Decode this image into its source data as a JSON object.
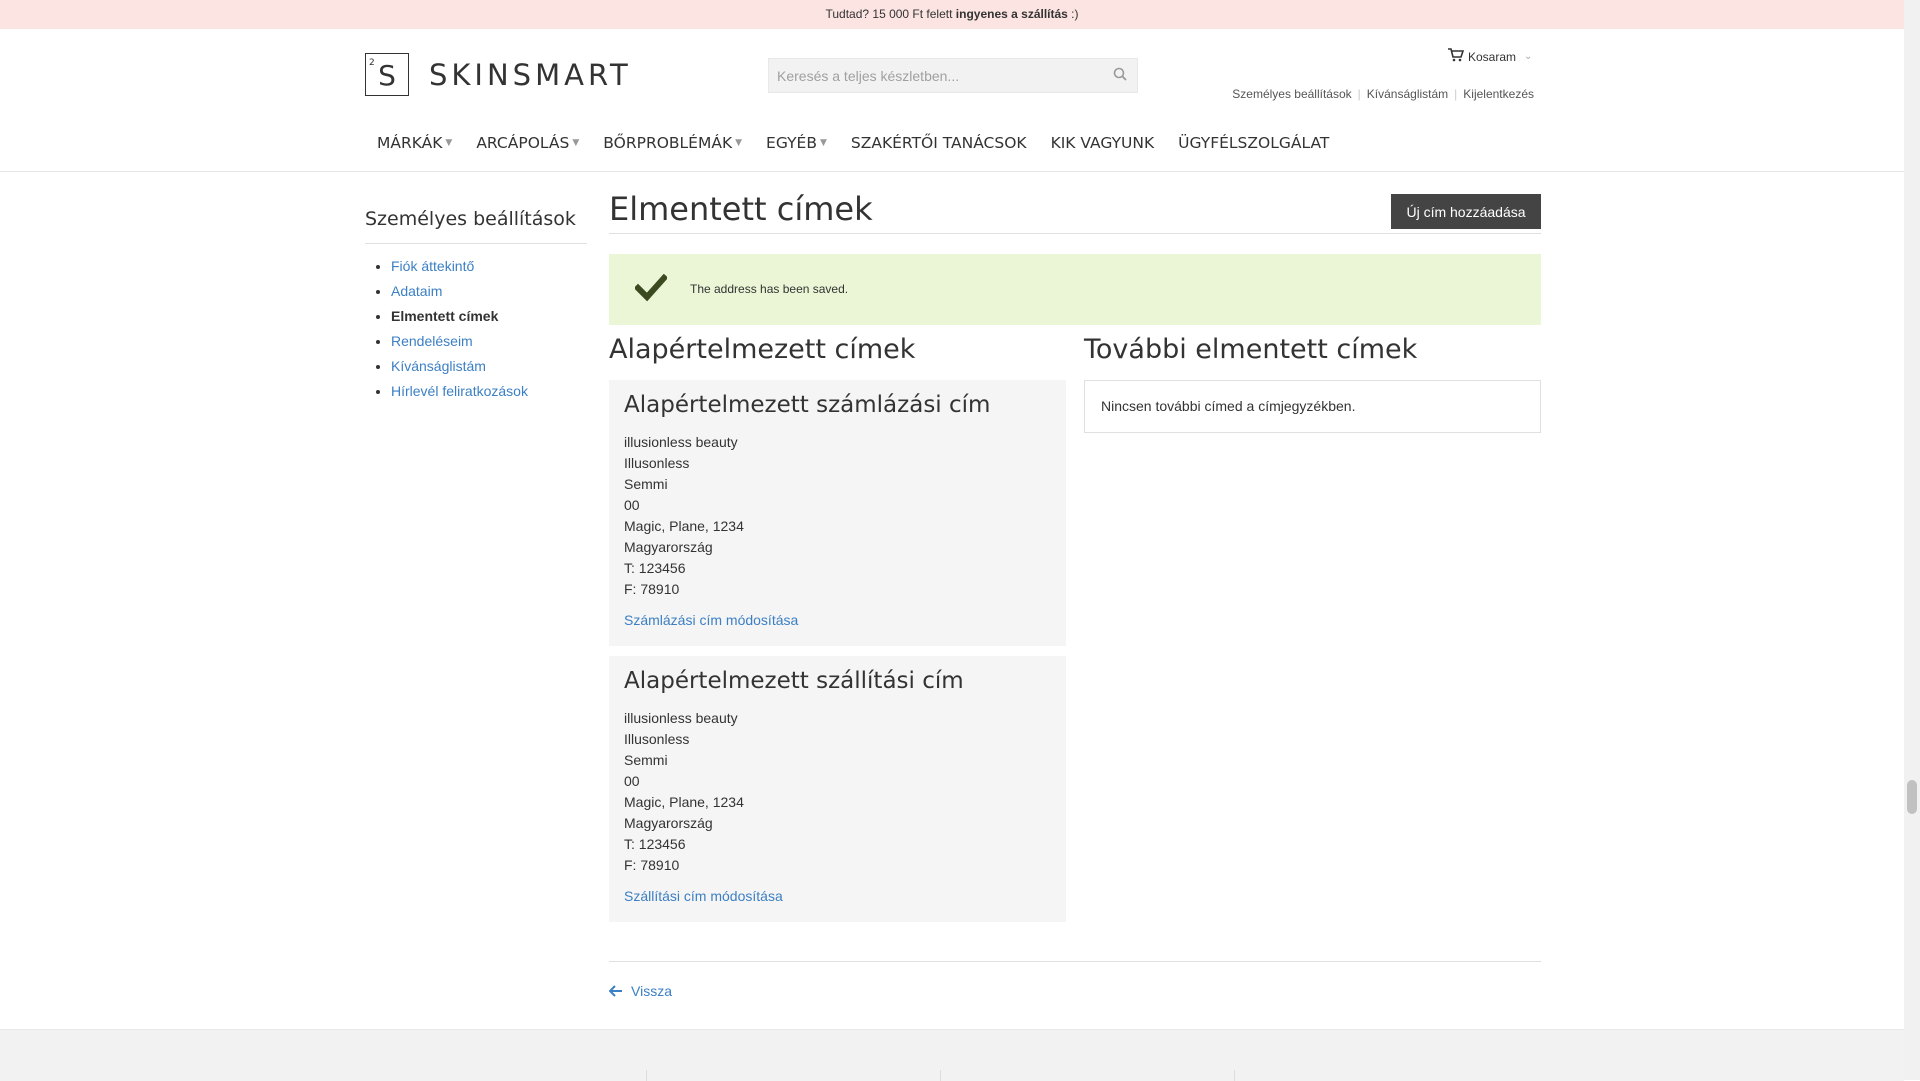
{
  "promo": {
    "prefix": "Tudtad? 15 000 Ft felett ",
    "bold": "ingyenes a szállítás",
    "suffix": " :)"
  },
  "brand": {
    "logo_letter": "S",
    "logo_sup": "2",
    "name": "SKINSMART"
  },
  "search": {
    "placeholder": "Keresés a teljes készletben..."
  },
  "cart": {
    "label": "Kosaram"
  },
  "toplinks": [
    "Személyes beállítások",
    "Kívánságlistám",
    "Kijelentkezés"
  ],
  "nav": [
    {
      "label": "MÁRKÁK",
      "has_dropdown": true
    },
    {
      "label": "ARCÁPOLÁS",
      "has_dropdown": true
    },
    {
      "label": "BŐRPROBLÉMÁK",
      "has_dropdown": true
    },
    {
      "label": "EGYÉB",
      "has_dropdown": true
    },
    {
      "label": "SZAKÉRTŐI TANÁCSOK",
      "has_dropdown": false
    },
    {
      "label": "KIK VAGYUNK",
      "has_dropdown": false
    },
    {
      "label": "ÜGYFÉLSZOLGÁLAT",
      "has_dropdown": false
    }
  ],
  "sidebar": {
    "title": "Személyes beállítások",
    "items": [
      {
        "label": "Fiók áttekintő",
        "current": false
      },
      {
        "label": "Adataim",
        "current": false
      },
      {
        "label": "Elmentett címek",
        "current": true
      },
      {
        "label": "Rendeléseim",
        "current": false
      },
      {
        "label": "Kívánságlistám",
        "current": false
      },
      {
        "label": "Hírlevél feliratkozások",
        "current": false
      }
    ]
  },
  "main": {
    "title": "Elmentett címek",
    "add_button": "Új cím hozzáadása",
    "success_message": "The address has been saved.",
    "default_heading": "Alapértelmezett címek",
    "other_heading": "További elmentett címek",
    "billing": {
      "heading": "Alapértelmezett számlázási cím",
      "lines": [
        "illusionless beauty",
        "Illusonless",
        "Semmi",
        "00",
        "Magic, Plane, 1234",
        "Magyarország",
        "T: 123456",
        "F: 78910"
      ],
      "edit": "Számlázási cím módosítása"
    },
    "shipping": {
      "heading": "Alapértelmezett szállítási cím",
      "lines": [
        "illusionless beauty",
        "Illusonless",
        "Semmi",
        "00",
        "Magic, Plane, 1234",
        "Magyarország",
        "T: 123456",
        "F: 78910"
      ],
      "edit": "Szállítási cím módosítása"
    },
    "empty_message": "Nincsen további címed a címjegyzékben.",
    "back": "Vissza"
  },
  "colors": {
    "link": "#3b7fc4",
    "success_bg": "#eaf6d6",
    "check": "#3c4a20",
    "promo_bg": "#fce4e2",
    "button_bg": "#444444"
  }
}
